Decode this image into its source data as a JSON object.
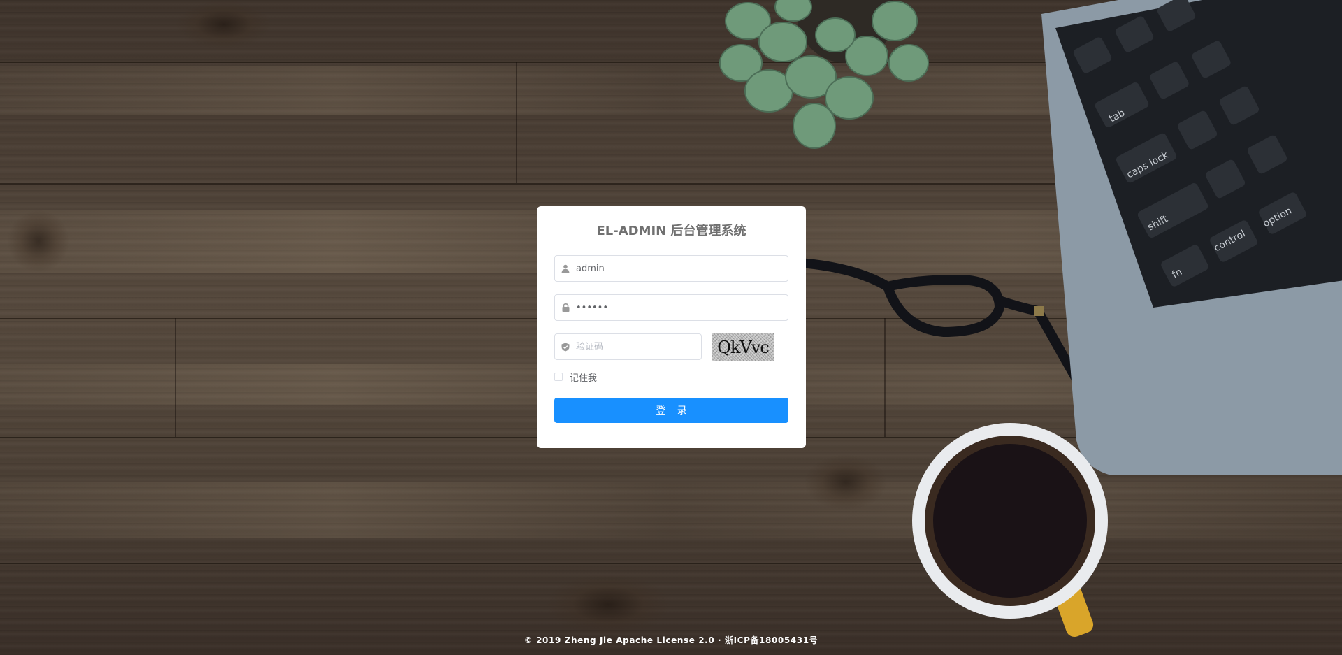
{
  "login": {
    "title": "EL-ADMIN 后台管理系统",
    "username": {
      "value": "admin",
      "icon": "user-icon"
    },
    "password": {
      "value": "••••••",
      "icon": "lock-icon"
    },
    "captcha": {
      "placeholder": "验证码",
      "image_text": "QkVvc",
      "icon": "shield-check-icon"
    },
    "remember_me": {
      "label": "记住我",
      "checked": false
    },
    "submit_label": "登 录"
  },
  "footer": {
    "text": "© 2019 Zheng Jie Apache License 2.0 · 浙ICP备18005431号"
  },
  "theme": {
    "accent": "#1890ff",
    "card_bg": "#ffffff",
    "title_color": "#707070"
  }
}
